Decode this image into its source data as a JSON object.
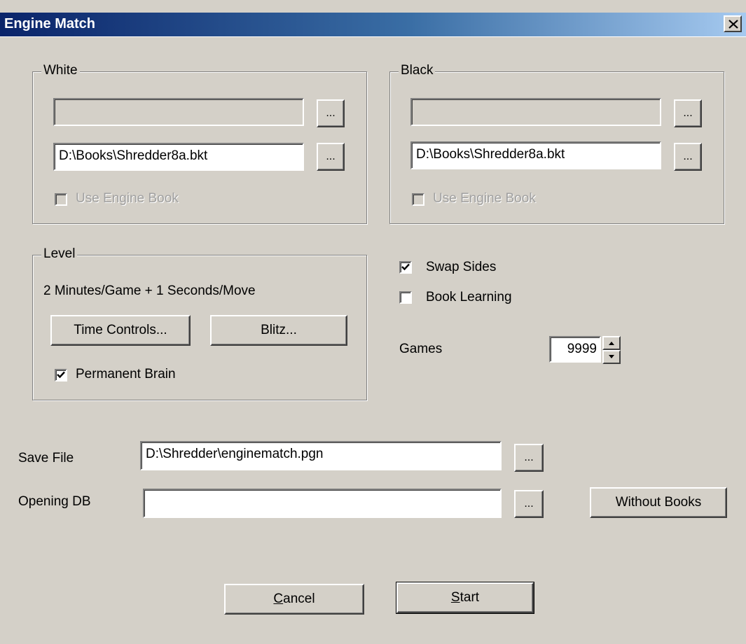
{
  "window": {
    "title": "Engine Match"
  },
  "white": {
    "legend": "White",
    "engine_value": "",
    "engine_browse_label": "...",
    "book_value": "D:\\Books\\Shredder8a.bkt",
    "book_browse_label": "...",
    "use_engine_book_label": "Use Engine Book",
    "use_engine_book_checked": false
  },
  "black": {
    "legend": "Black",
    "engine_value": "",
    "engine_browse_label": "...",
    "book_value": "D:\\Books\\Shredder8a.bkt",
    "book_browse_label": "...",
    "use_engine_book_label": "Use Engine Book",
    "use_engine_book_checked": false
  },
  "level": {
    "legend": "Level",
    "description": "2 Minutes/Game + 1 Seconds/Move",
    "time_controls_label": "Time Controls...",
    "blitz_label": "Blitz...",
    "permanent_brain_label": "Permanent Brain",
    "permanent_brain_checked": true
  },
  "options": {
    "swap_sides_label": "Swap Sides",
    "swap_sides_checked": true,
    "book_learning_label": "Book Learning",
    "book_learning_checked": false,
    "games_label": "Games",
    "games_value": "9999"
  },
  "files": {
    "save_file_label": "Save File",
    "save_file_value": "D:\\Shredder\\enginematch.pgn",
    "save_browse_label": "...",
    "opening_db_label": "Opening DB",
    "opening_db_value": "",
    "opening_browse_label": "...",
    "without_books_label": "Without Books"
  },
  "actions": {
    "cancel_first": "C",
    "cancel_rest": "ancel",
    "start_first": "S",
    "start_rest": "tart"
  }
}
